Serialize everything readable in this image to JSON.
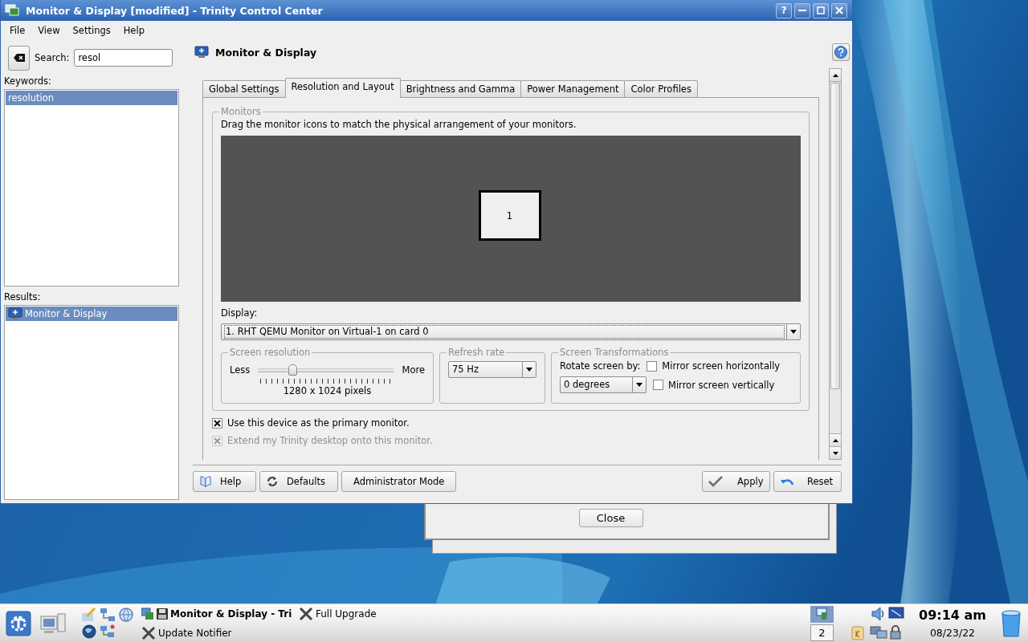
{
  "window": {
    "title": "Monitor & Display [modified] - Trinity Control Center",
    "buttons": [
      {
        "kind": "help",
        "glyph": "?"
      },
      {
        "kind": "minimize"
      },
      {
        "kind": "maximize"
      },
      {
        "kind": "close"
      }
    ]
  },
  "menu": [
    "File",
    "View",
    "Settings",
    "Help"
  ],
  "sidebar": {
    "search_label": "Search:",
    "search_value": "resol",
    "keywords_label": "Keywords:",
    "keywords": [
      {
        "label": "resolution",
        "selected": true
      }
    ],
    "results_label": "Results:",
    "results": [
      {
        "label": "Monitor & Display",
        "selected": true
      }
    ]
  },
  "module": {
    "title": "Monitor & Display"
  },
  "tabs": [
    {
      "label": "Global Settings",
      "selected": false
    },
    {
      "label": "Resolution and Layout",
      "selected": true
    },
    {
      "label": "Brightness and Gamma",
      "selected": false
    },
    {
      "label": "Power Management",
      "selected": false
    },
    {
      "label": "Color Profiles",
      "selected": false
    }
  ],
  "monitors": {
    "legend": "Monitors",
    "hint": "Drag the monitor icons to match the physical arrangement of your monitors.",
    "tiles": [
      {
        "label": "1"
      }
    ]
  },
  "display": {
    "label": "Display:",
    "value": "1. RHT QEMU Monitor on Virtual-1 on card 0"
  },
  "resolution": {
    "legend": "Screen resolution",
    "min_label": "Less",
    "max_label": "More",
    "level": 0.25,
    "reading": "1280 x 1024 pixels"
  },
  "refresh": {
    "legend": "Refresh rate",
    "value": "75 Hz"
  },
  "transformations": {
    "legend": "Screen Transformations",
    "rotate_label": "Rotate screen by:",
    "rotate_value": "0 degrees",
    "options": [
      {
        "label": "Mirror screen horizontally",
        "checked": false
      },
      {
        "label": "Mirror screen vertically",
        "checked": false
      }
    ]
  },
  "checks": [
    {
      "label": "Use this device as the primary monitor.",
      "checked": true,
      "disabled": false
    },
    {
      "label": "Extend my Trinity desktop onto this monitor.",
      "checked": true,
      "disabled": true
    }
  ],
  "buttons_left": [
    {
      "kind": "help",
      "label": "Help"
    },
    {
      "kind": "defaults",
      "label": "Defaults"
    },
    {
      "kind": "admin",
      "label": "Administrator Mode"
    }
  ],
  "buttons_right": [
    {
      "kind": "apply",
      "label": "Apply"
    },
    {
      "kind": "reset",
      "label": "Reset"
    }
  ],
  "dialog": {
    "button": "Close"
  },
  "taskbar": {
    "tasks": [
      {
        "label": "Monitor & Display - Tri",
        "active": true,
        "kind": "monitor"
      },
      {
        "label": "Full Upgrade",
        "active": false,
        "kind": "x"
      },
      {
        "label": "Update Notifier",
        "active": false,
        "kind": "x"
      }
    ],
    "desktop_number": "2",
    "time": "09:14 am",
    "date": "08/23/22"
  }
}
